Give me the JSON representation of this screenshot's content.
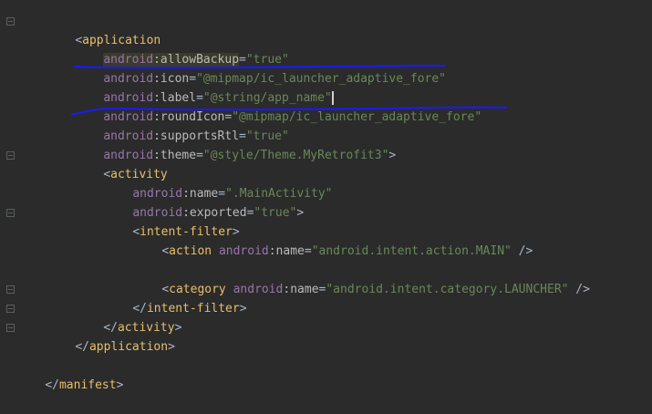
{
  "lines": [
    {
      "open": "<",
      "tag": "application"
    },
    {
      "ns": "android",
      "attr": ":allowBackup",
      "eq": "=",
      "val": "\"true\""
    },
    {
      "ns": "android",
      "attr": ":icon",
      "eq": "=",
      "val": "\"@mipmap/ic_launcher_adaptive_fore\""
    },
    {
      "ns": "android",
      "attr": ":label",
      "eq": "=",
      "val": "\"@string/app_name\""
    },
    {
      "ns": "android",
      "attr": ":roundIcon",
      "eq": "=",
      "val": "\"@mipmap/ic_launcher_adaptive_fore\""
    },
    {
      "ns": "android",
      "attr": ":supportsRtl",
      "eq": "=",
      "val": "\"true\""
    },
    {
      "ns": "android",
      "attr": ":theme",
      "eq": "=",
      "val": "\"@style/Theme.MyRetrofit3\"",
      "close": ">"
    },
    {
      "open": "<",
      "tag": "activity"
    },
    {
      "ns": "android",
      "attr": ":name",
      "eq": "=",
      "val": "\".MainActivity\""
    },
    {
      "ns": "android",
      "attr": ":exported",
      "eq": "=",
      "val": "\"true\"",
      "close": ">"
    },
    {
      "open": "<",
      "tag": "intent-filter",
      "close": ">"
    },
    {
      "open": "<",
      "tag": "action",
      "ns": "android",
      "attr": ":name",
      "eq": "=",
      "val": "\"android.intent.action.MAIN\"",
      "close": " />"
    },
    {
      "open": "<",
      "tag": "category",
      "ns": "android",
      "attr": ":name",
      "eq": "=",
      "val": "\"android.intent.category.LAUNCHER\"",
      "close": " />"
    },
    {
      "open": "</",
      "tag": "intent-filter",
      "close": ">"
    },
    {
      "open": "</",
      "tag": "activity",
      "close": ">"
    },
    {
      "open": "</",
      "tag": "application",
      "close": ">"
    },
    {
      "open": "</",
      "tag": "manifest",
      "close": ">"
    }
  ],
  "colors": {
    "background": "#2b2b2b",
    "tag": "#e8bf6a",
    "namespace": "#9876aa",
    "attribute": "#bababa",
    "value": "#6a8759",
    "annotation_ink": "#1a1aff"
  }
}
